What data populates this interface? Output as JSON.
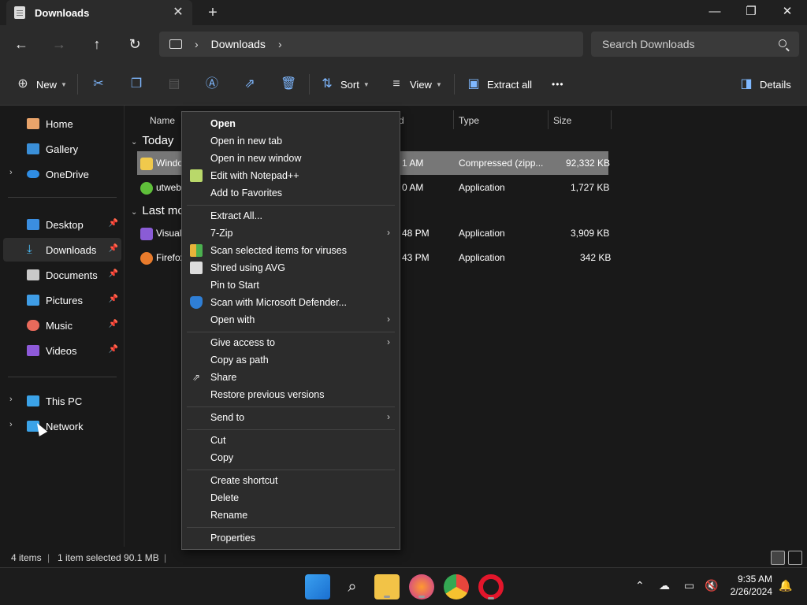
{
  "window": {
    "tab_title": "Downloads",
    "new_tab_glyph": "+",
    "close_tab_glyph": "✕"
  },
  "address": {
    "breadcrumb": "Downloads",
    "search_placeholder": "Search Downloads"
  },
  "commandbar": {
    "new_label": "New",
    "sort_label": "Sort",
    "view_label": "View",
    "extract_label": "Extract all",
    "more_label": "•••",
    "details_label": "Details"
  },
  "sidebar": {
    "items": [
      {
        "label": "Home"
      },
      {
        "label": "Gallery"
      },
      {
        "label": "OneDrive"
      },
      {
        "label": "Desktop"
      },
      {
        "label": "Downloads"
      },
      {
        "label": "Documents"
      },
      {
        "label": "Pictures"
      },
      {
        "label": "Music"
      },
      {
        "label": "Videos"
      },
      {
        "label": "This PC"
      },
      {
        "label": "Network"
      }
    ]
  },
  "content": {
    "columns": {
      "name": "Name",
      "date": "d",
      "type": "Type",
      "size": "Size"
    },
    "groups": {
      "today": "Today",
      "last": "Last mo"
    },
    "files": [
      {
        "name": "Windo",
        "date": "1 AM",
        "type": "Compressed (zipp...",
        "size": "92,332 KB"
      },
      {
        "name": "utweb",
        "date": "0 AM",
        "type": "Application",
        "size": "1,727 KB"
      },
      {
        "name": "Visual",
        "date": "48 PM",
        "type": "Application",
        "size": "3,909 KB"
      },
      {
        "name": "Firefox",
        "date": "43 PM",
        "type": "Application",
        "size": "342 KB"
      }
    ]
  },
  "status": {
    "count": "4 items",
    "selection": "1 item selected  90.1 MB"
  },
  "context_menu": {
    "items": [
      {
        "label": "Open"
      },
      {
        "label": "Open in new tab"
      },
      {
        "label": "Open in new window"
      },
      {
        "label": "Edit with Notepad++"
      },
      {
        "label": "Add to Favorites"
      },
      {
        "label": "Extract All..."
      },
      {
        "label": "7-Zip"
      },
      {
        "label": "Scan selected items for viruses"
      },
      {
        "label": "Shred using AVG"
      },
      {
        "label": "Pin to Start"
      },
      {
        "label": "Scan with Microsoft Defender..."
      },
      {
        "label": "Open with"
      },
      {
        "label": "Give access to"
      },
      {
        "label": "Copy as path"
      },
      {
        "label": "Share"
      },
      {
        "label": "Restore previous versions"
      },
      {
        "label": "Send to"
      },
      {
        "label": "Cut"
      },
      {
        "label": "Copy"
      },
      {
        "label": "Create shortcut"
      },
      {
        "label": "Delete"
      },
      {
        "label": "Rename"
      },
      {
        "label": "Properties"
      }
    ]
  },
  "taskbar": {
    "time": "9:35 AM",
    "date": "2/26/2024"
  },
  "colors": {
    "accent": "#4cc2ff",
    "selected_row": "#777777"
  }
}
